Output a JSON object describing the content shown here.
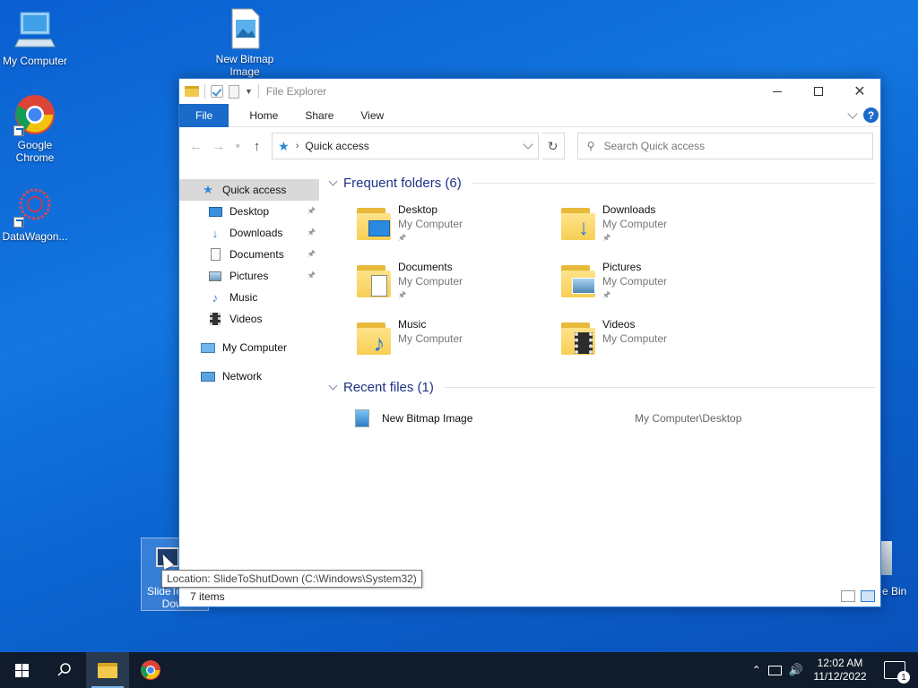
{
  "desktop": {
    "icons": [
      {
        "label": "My Computer"
      },
      {
        "label": "New Bitmap Image"
      },
      {
        "label": "Google Chrome"
      },
      {
        "label": "DataWagon..."
      },
      {
        "label": "SlideToShutDown"
      },
      {
        "label": "e Bin"
      }
    ],
    "tooltip": "Location: SlideToShutDown (C:\\Windows\\System32)"
  },
  "window": {
    "title": "File Explorer",
    "ribbon_tabs": [
      "File",
      "Home",
      "Share",
      "View"
    ],
    "help_label": "?",
    "address": {
      "crumb": "Quick access"
    },
    "search": {
      "placeholder": "Search Quick access"
    },
    "nav": {
      "quick_access": "Quick access",
      "pinned": [
        {
          "label": "Desktop",
          "pinned": true
        },
        {
          "label": "Downloads",
          "pinned": true
        },
        {
          "label": "Documents",
          "pinned": true
        },
        {
          "label": "Pictures",
          "pinned": true
        },
        {
          "label": "Music",
          "pinned": false
        },
        {
          "label": "Videos",
          "pinned": false
        }
      ],
      "my_computer": "My Computer",
      "network": "Network"
    },
    "frequent": {
      "heading": "Frequent folders (6)",
      "items": [
        {
          "name": "Desktop",
          "location": "My Computer",
          "pinned": true
        },
        {
          "name": "Downloads",
          "location": "My Computer",
          "pinned": true
        },
        {
          "name": "Documents",
          "location": "My Computer",
          "pinned": true
        },
        {
          "name": "Pictures",
          "location": "My Computer",
          "pinned": true
        },
        {
          "name": "Music",
          "location": "My Computer",
          "pinned": false
        },
        {
          "name": "Videos",
          "location": "My Computer",
          "pinned": false
        }
      ]
    },
    "recent": {
      "heading": "Recent files (1)",
      "items": [
        {
          "name": "New Bitmap Image",
          "path": "My Computer\\Desktop"
        }
      ]
    },
    "status": "7 items"
  },
  "taskbar": {
    "time": "12:02 AM",
    "date": "11/12/2022",
    "notification_count": "1"
  },
  "colors": {
    "accent": "#1a6ac9",
    "group_heading": "#1e3287",
    "taskbar": "#101c2b"
  }
}
